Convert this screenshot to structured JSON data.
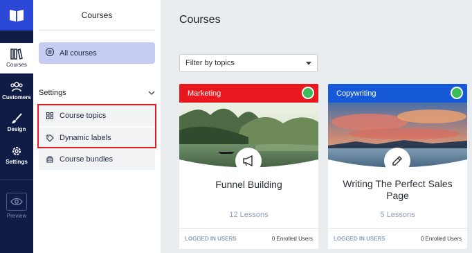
{
  "rail": {
    "items": [
      {
        "label": "Courses",
        "icon": "books-icon",
        "active": true
      },
      {
        "label": "Customers",
        "icon": "users-icon"
      },
      {
        "label": "Design",
        "icon": "brush-icon"
      },
      {
        "label": "Settings",
        "icon": "gear-icon"
      },
      {
        "label": "Preview",
        "icon": "eye-icon"
      }
    ]
  },
  "sidebar": {
    "title": "Courses",
    "all_courses": "All courses",
    "settings_header": "Settings",
    "items": [
      {
        "label": "Course topics",
        "icon": "grid-icon"
      },
      {
        "label": "Dynamic labels",
        "icon": "tag-icon"
      },
      {
        "label": "Course bundles",
        "icon": "bundle-icon"
      }
    ]
  },
  "main": {
    "title": "Courses",
    "filter_placeholder": "Filter by topics"
  },
  "cards": [
    {
      "topic": "Marketing",
      "topic_color": "#e8181e",
      "name": "Funnel Building",
      "lessons": "12 Lessons",
      "access": "LOGGED IN USERS",
      "enrolled": "0 Enrolled Users",
      "icon": "megaphone-icon"
    },
    {
      "topic": "Copywriting",
      "topic_color": "#1659d6",
      "name": "Writing The Perfect Sales Page",
      "lessons": "5 Lessons",
      "access": "LOGGED IN USERS",
      "enrolled": "0 Enrolled Users",
      "icon": "pencil-icon"
    }
  ],
  "colors": {
    "rail": "#101c45",
    "accent": "#2b48d6",
    "active_item": "#c7cdf2",
    "status_green": "#3bbd5a",
    "highlight": "#e01b24"
  }
}
